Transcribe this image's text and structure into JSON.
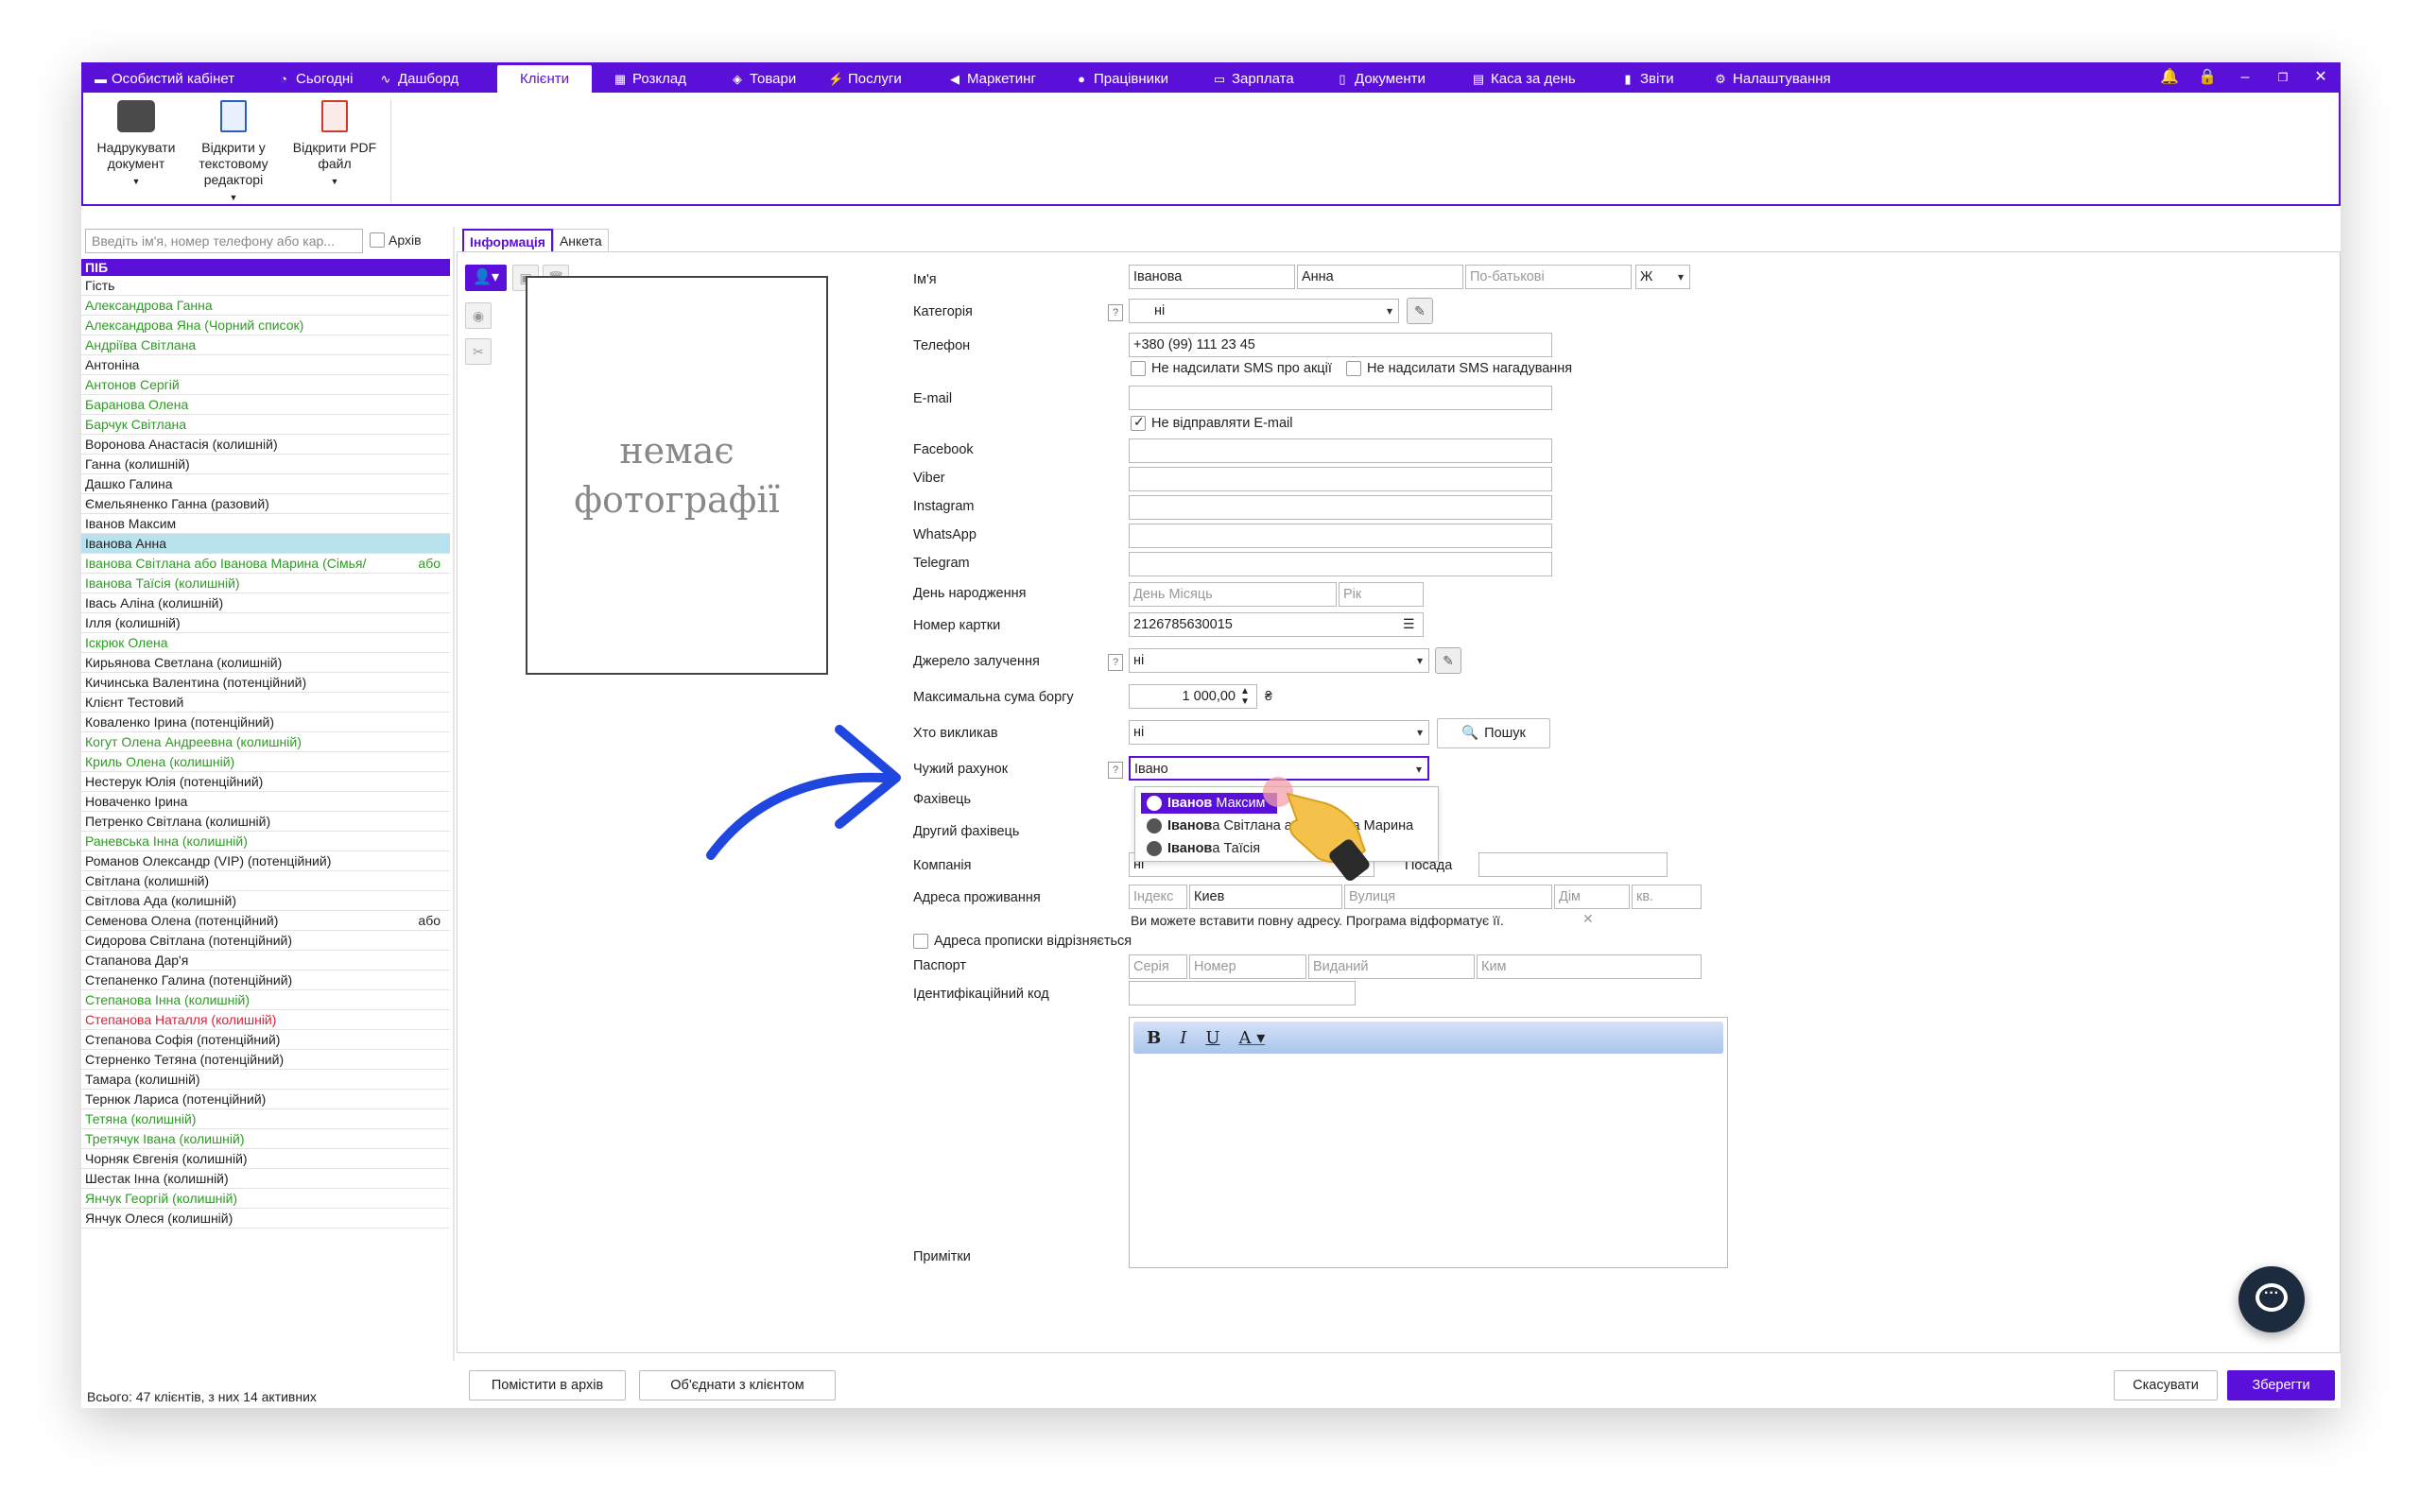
{
  "colors": {
    "accent": "#5a10d8",
    "selection": "#b8e2ee",
    "green_text": "#2f9a25",
    "red_text": "#e0203a",
    "arrow": "#1f47e0"
  },
  "menu": [
    {
      "label": "Особистий кабінет",
      "icon": "cabinet-icon"
    },
    {
      "label": "Сьогодні",
      "icon": "clock-icon"
    },
    {
      "label": "Дашборд",
      "icon": "pulse-icon"
    },
    {
      "label": "Клієнти",
      "icon": "",
      "active": true
    },
    {
      "label": "Розклад",
      "icon": "calendar-icon"
    },
    {
      "label": "Товари",
      "icon": "box-icon"
    },
    {
      "label": "Послуги",
      "icon": "bolt-icon"
    },
    {
      "label": "Маркетинг",
      "icon": "megaphone-icon"
    },
    {
      "label": "Працівники",
      "icon": "person-icon"
    },
    {
      "label": "Зарплата",
      "icon": "money-icon"
    },
    {
      "label": "Документи",
      "icon": "document-icon"
    },
    {
      "label": "Каса за день",
      "icon": "calculator-icon"
    },
    {
      "label": "Звіти",
      "icon": "bar-chart-icon"
    },
    {
      "label": "Налаштування",
      "icon": "gear-icon"
    }
  ],
  "ribbon": [
    {
      "label_l1": "Надрукувати",
      "label_l2": "документ",
      "label_l3": "",
      "icon": "printer-icon"
    },
    {
      "label_l1": "Відкрити у",
      "label_l2": "текстовому",
      "label_l3": "редакторі",
      "icon": "word-doc-icon"
    },
    {
      "label_l1": "Відкрити PDF",
      "label_l2": "файл",
      "label_l3": "",
      "icon": "pdf-icon"
    }
  ],
  "sidebar": {
    "search_placeholder": "Введіть ім'я, номер телефону або кар...",
    "archive_label": "Архів",
    "column_header": "ПІБ",
    "total": "Всього: 47 клієнтів, з них 14 активних",
    "clients": [
      {
        "name": "Гість",
        "style": ""
      },
      {
        "name": "Александрова Ганна",
        "style": "g"
      },
      {
        "name": "Александрова Яна (Чорний список)",
        "style": "g"
      },
      {
        "name": "Андріїва Світлана",
        "style": "g"
      },
      {
        "name": "Антоніна",
        "style": ""
      },
      {
        "name": "Антонов Сергій",
        "style": "g"
      },
      {
        "name": "Баранова Олена",
        "style": "g"
      },
      {
        "name": "Барчук Світлана",
        "style": "g"
      },
      {
        "name": "Воронова Анастасія (колишній)",
        "style": ""
      },
      {
        "name": "Ганна (колишній)",
        "style": ""
      },
      {
        "name": "Дашко Галина",
        "style": ""
      },
      {
        "name": "Ємельяненко Ганна (разовий)",
        "style": ""
      },
      {
        "name": "Іванов Максим",
        "style": ""
      },
      {
        "name": "Іванова Анна",
        "style": "sel"
      },
      {
        "name": "Іванова Світлана  або Іванова  Марина (Сімья/",
        "style": "g",
        "suffix": "або"
      },
      {
        "name": "Іванова Таїсія (колишній)",
        "style": "g"
      },
      {
        "name": "Івась Аліна (колишній)",
        "style": ""
      },
      {
        "name": "Ілля (колишній)",
        "style": ""
      },
      {
        "name": "Іскрюк Олена",
        "style": "g"
      },
      {
        "name": "Кирьянова Светлана (колишній)",
        "style": ""
      },
      {
        "name": "Кичинська Валентина (потенційний)",
        "style": ""
      },
      {
        "name": "Клієнт Тестовий",
        "style": ""
      },
      {
        "name": "Коваленко Ірина (потенційний)",
        "style": ""
      },
      {
        "name": "Когут Олена Андреевна (колишній)",
        "style": "g"
      },
      {
        "name": "Криль Олена (колишній)",
        "style": "g"
      },
      {
        "name": "Нестерук Юлія (потенційний)",
        "style": ""
      },
      {
        "name": "Новаченко Ірина",
        "style": ""
      },
      {
        "name": "Петренко Світлана (колишній)",
        "style": ""
      },
      {
        "name": "Раневська Інна (колишній)",
        "style": "g"
      },
      {
        "name": "Романов Олександр (VIP) (потенційний)",
        "style": ""
      },
      {
        "name": "Світлана (колишній)",
        "style": ""
      },
      {
        "name": "Світлова Ада (колишній)",
        "style": ""
      },
      {
        "name": "Семенова Олена (потенційний)",
        "style": "",
        "suffix": "або"
      },
      {
        "name": "Сидорова Світлана (потенційний)",
        "style": ""
      },
      {
        "name": "Стапанова Дар'я",
        "style": ""
      },
      {
        "name": "Степаненко Галина (потенційний)",
        "style": ""
      },
      {
        "name": "Степанова Інна (колишній)",
        "style": "g"
      },
      {
        "name": "Степанова Наталля (колишній)",
        "style": "r"
      },
      {
        "name": "Степанова Софія (потенційний)",
        "style": ""
      },
      {
        "name": "Стерненко Тетяна (потенційний)",
        "style": ""
      },
      {
        "name": "Тамара (колишній)",
        "style": ""
      },
      {
        "name": "Тернюк Лариса (потенційний)",
        "style": ""
      },
      {
        "name": "Тетяна (колишній)",
        "style": "g"
      },
      {
        "name": "Третячук Івана (колишній)",
        "style": "g"
      },
      {
        "name": "Чорняк Євгенія (колишній)",
        "style": ""
      },
      {
        "name": "Шестак Інна (колишній)",
        "style": ""
      },
      {
        "name": "Янчук Георгій (колишній)",
        "style": "g"
      },
      {
        "name": "Янчук Олеся (колишній)",
        "style": ""
      }
    ]
  },
  "tabs": {
    "info": "Інформація",
    "form": "Анкета"
  },
  "photo_placeholder": "немає фотографії",
  "form": {
    "name_label": "Ім'я",
    "last_name": "Іванова",
    "first_name": "Анна",
    "patronymic_placeholder": "По-батькові",
    "gender": "Ж",
    "category_label": "Категорія",
    "category_value": "ні",
    "phone_label": "Телефон",
    "phone_value": "+380 (99) 111 23 45",
    "no_sms_promo": "Не надсилати SMS про акції",
    "no_sms_reminder": "Не надсилати SMS нагадування",
    "email_label": "E-mail",
    "no_email": "Не відправляти E-mail",
    "facebook_label": "Facebook",
    "viber_label": "Viber",
    "instagram_label": "Instagram",
    "whatsapp_label": "WhatsApp",
    "telegram_label": "Telegram",
    "birthday_label": "День народження",
    "birthday_placeholder": "День Місяць",
    "year_placeholder": "Рік",
    "card_label": "Номер картки",
    "card_value": "2126785630015",
    "source_label": "Джерело залучення",
    "source_value": "ні",
    "debt_label": "Максимальна сума боргу",
    "debt_value": "1 000,00",
    "currency": "₴",
    "invited_label": "Хто викликав",
    "invited_value": "ні",
    "search_button": "Пошук",
    "foreign_label": "Чужий рахунок",
    "foreign_value": "Івано",
    "specialist_label": "Фахівець",
    "other_specialist_label": "Другий фахівець",
    "company_label": "Компанія",
    "company_value": "ні",
    "position_label": "Посада",
    "address_label": "Адреса проживання",
    "index_placeholder": "Індекс",
    "city_value": "Киев",
    "street_placeholder": "Вулиця",
    "house_placeholder": "Дім",
    "apt_placeholder": "кв.",
    "address_hint": "Ви можете вставити повну адресу. Програма відформатує її.",
    "reg_address_diff": "Адреса прописки відрізняється",
    "passport_label": "Паспорт",
    "series_placeholder": "Серія",
    "number_placeholder": "Номер",
    "issued_placeholder": "Виданий",
    "by_placeholder": "Ким",
    "id_code_label": "Ідентифікаційний код",
    "notes_label": "Примітки"
  },
  "suggestions": [
    {
      "match": "Іванов",
      "rest": " Максим",
      "highlighted": true
    },
    {
      "match": "Іванов",
      "rest": "а Світлана або Іванова Марина",
      "highlighted": false
    },
    {
      "match": "Іванов",
      "rest": "а Таїсія",
      "highlighted": false
    }
  ],
  "buttons": {
    "archive": "Помістити в архів",
    "merge": "Об'єднати з клієнтом",
    "cancel": "Скасувати",
    "save": "Зберегти"
  }
}
